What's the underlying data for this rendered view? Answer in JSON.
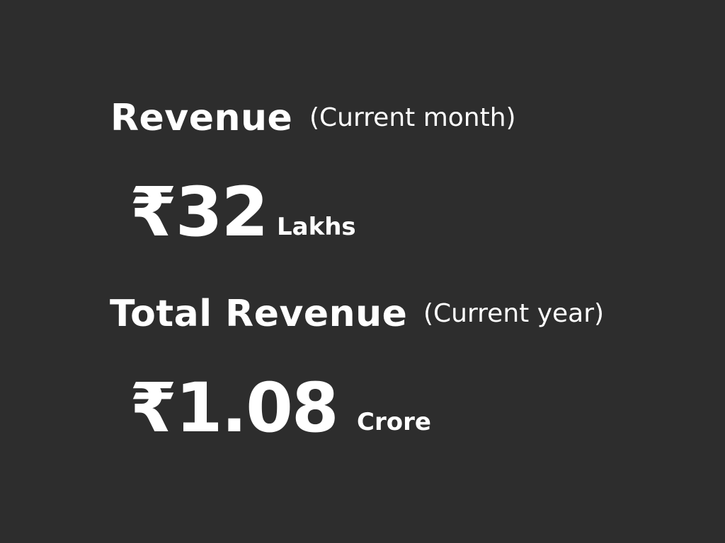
{
  "current_month": {
    "heading": "Revenue",
    "period": "(Current month)",
    "amount": "₹32",
    "unit": "Lakhs"
  },
  "current_year": {
    "heading": "Total Revenue",
    "period": "(Current year)",
    "amount": "₹1.08",
    "unit": "Crore"
  },
  "colors": {
    "background": "#2d2d2d",
    "text": "#ffffff"
  }
}
